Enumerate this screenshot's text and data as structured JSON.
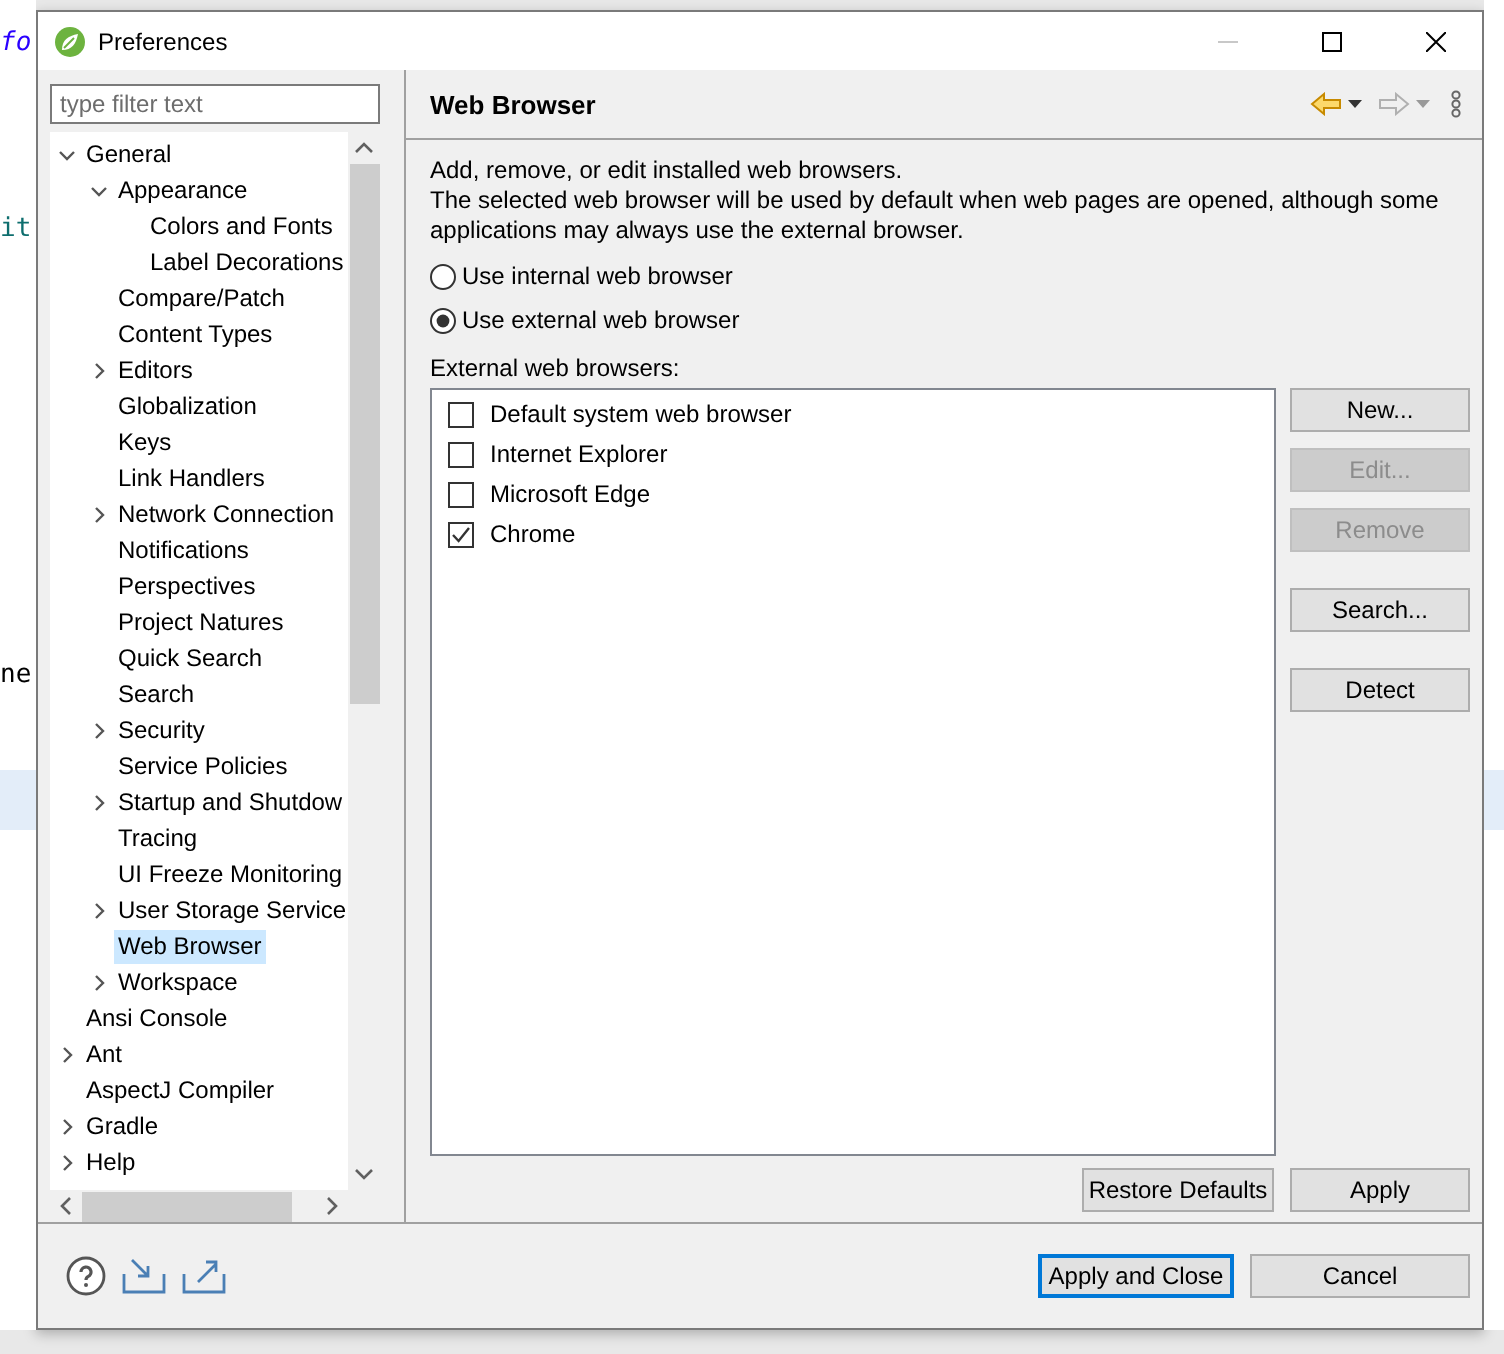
{
  "background": {
    "fragments": [
      "fo",
      "it",
      "ne"
    ]
  },
  "window": {
    "title": "Preferences"
  },
  "filter": {
    "placeholder": "type filter text"
  },
  "tree": [
    {
      "label": "General",
      "expanded": true,
      "selected": false,
      "children": [
        {
          "label": "Appearance",
          "expanded": true,
          "selected": false,
          "children": [
            {
              "label": "Colors and Fonts",
              "selected": false
            },
            {
              "label": "Label Decorations",
              "selected": false
            }
          ]
        },
        {
          "label": "Compare/Patch",
          "selected": false
        },
        {
          "label": "Content Types",
          "selected": false
        },
        {
          "label": "Editors",
          "expanded": false,
          "selected": false
        },
        {
          "label": "Globalization",
          "selected": false
        },
        {
          "label": "Keys",
          "selected": false
        },
        {
          "label": "Link Handlers",
          "selected": false
        },
        {
          "label": "Network Connection",
          "expanded": false,
          "selected": false
        },
        {
          "label": "Notifications",
          "selected": false
        },
        {
          "label": "Perspectives",
          "selected": false
        },
        {
          "label": "Project Natures",
          "selected": false
        },
        {
          "label": "Quick Search",
          "selected": false
        },
        {
          "label": "Search",
          "selected": false
        },
        {
          "label": "Security",
          "expanded": false,
          "selected": false
        },
        {
          "label": "Service Policies",
          "selected": false
        },
        {
          "label": "Startup and Shutdow",
          "expanded": false,
          "selected": false
        },
        {
          "label": "Tracing",
          "selected": false
        },
        {
          "label": "UI Freeze Monitoring",
          "selected": false
        },
        {
          "label": "User Storage Service",
          "expanded": false,
          "selected": false
        },
        {
          "label": "Web Browser",
          "selected": true
        },
        {
          "label": "Workspace",
          "expanded": false,
          "selected": false
        }
      ]
    },
    {
      "label": "Ansi Console",
      "selected": false
    },
    {
      "label": "Ant",
      "expanded": false,
      "selected": false
    },
    {
      "label": "AspectJ Compiler",
      "selected": false
    },
    {
      "label": "Gradle",
      "expanded": false,
      "selected": false
    },
    {
      "label": "Help",
      "expanded": false,
      "selected": false
    }
  ],
  "page": {
    "title": "Web Browser",
    "nav": {
      "back_enabled": true,
      "forward_enabled": false
    },
    "description": [
      "Add, remove, or edit installed web browsers.",
      "The selected web browser will be used by default when web pages are opened, although some applications may always use the external browser."
    ],
    "modes": [
      {
        "label": "Use internal web browser",
        "selected": false
      },
      {
        "label": "Use external web browser",
        "selected": true
      }
    ],
    "list_label": "External web browsers:",
    "browsers": [
      {
        "label": "Default system web browser",
        "checked": false
      },
      {
        "label": "Internet Explorer",
        "checked": false
      },
      {
        "label": "Microsoft Edge",
        "checked": false
      },
      {
        "label": "Chrome",
        "checked": true
      }
    ],
    "side_buttons": [
      {
        "label": "New...",
        "disabled": false
      },
      {
        "label": "Edit...",
        "disabled": true
      },
      {
        "label": "Remove",
        "disabled": true
      },
      {
        "label": "Search...",
        "disabled": false
      },
      {
        "label": "Detect",
        "disabled": false
      }
    ],
    "buttons": [
      "Restore Defaults",
      "Apply"
    ]
  },
  "footer_buttons": [
    {
      "label": "Apply and Close",
      "default": true
    },
    {
      "label": "Cancel",
      "default": false
    }
  ]
}
